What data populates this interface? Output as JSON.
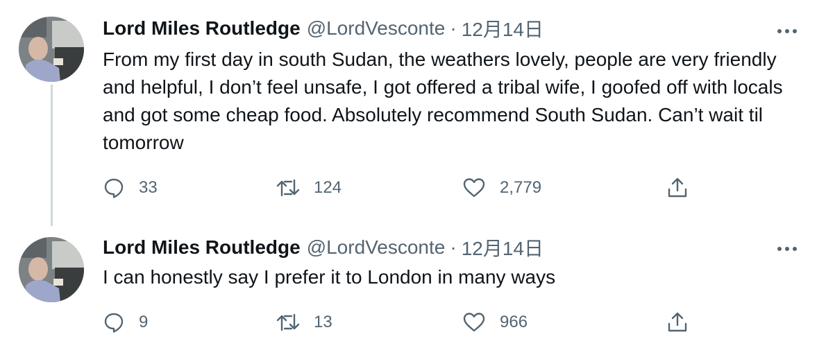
{
  "thread": {
    "tweets": [
      {
        "name": "Lord Miles Routledge",
        "handle": "@LordVesconte",
        "separator": "·",
        "date": "12月14日",
        "text": "From my first day in south Sudan, the weathers lovely, people are very friendly and helpful, I don’t feel unsafe, I got offered a tribal wife, I goofed off with locals and got some cheap food. Absolutely recommend South Sudan. Can’t wait til tomorrow",
        "replies": "33",
        "retweets": "124",
        "likes": "2,779"
      },
      {
        "name": "Lord Miles Routledge",
        "handle": "@LordVesconte",
        "separator": "·",
        "date": "12月14日",
        "text": "I can honestly say I prefer it to London in many ways",
        "replies": "9",
        "retweets": "13",
        "likes": "966"
      }
    ]
  },
  "icons": {
    "avatar": "avatar-photo",
    "more": "more-horizontal-icon",
    "reply": "reply-icon",
    "retweet": "retweet-icon",
    "like": "heart-icon",
    "share": "share-icon"
  },
  "colors": {
    "text_primary": "#0f1419",
    "text_secondary": "#536471",
    "thread_line": "#cfd9de",
    "background": "#ffffff"
  }
}
